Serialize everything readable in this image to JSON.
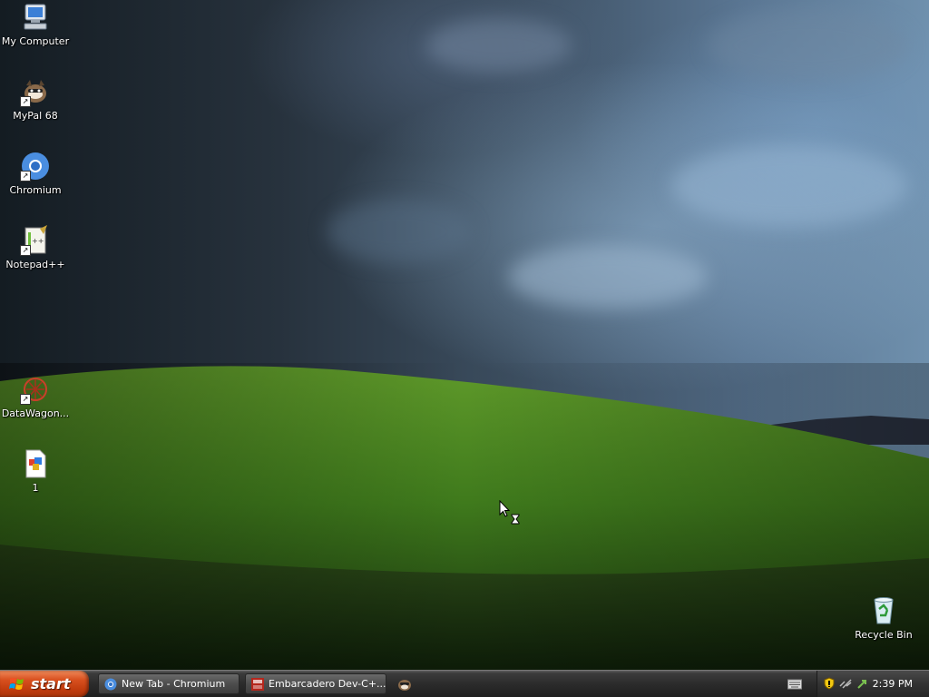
{
  "desktop": {
    "icons": [
      {
        "label": "My Computer",
        "icon": "my-computer-icon",
        "shortcut": false
      },
      {
        "label": "MyPal 68",
        "icon": "mypal-icon",
        "shortcut": true
      },
      {
        "label": "Chromium",
        "icon": "chromium-icon",
        "shortcut": true
      },
      {
        "label": "Notepad++",
        "icon": "notepad-plus-plus-icon",
        "shortcut": true
      },
      {
        "label": "DataWagon...",
        "icon": "datawagon-icon",
        "shortcut": true
      },
      {
        "label": "1",
        "icon": "image-file-icon",
        "shortcut": false
      },
      {
        "label": "Recycle Bin",
        "icon": "recycle-bin-icon",
        "shortcut": false
      }
    ],
    "cursor": "busy-arrow-hourglass"
  },
  "taskbar": {
    "start_label": "start",
    "tasks": [
      {
        "label": "New Tab - Chromium",
        "icon": "chromium-icon"
      },
      {
        "label": "Embarcadero Dev-C+...",
        "icon": "devcpp-icon"
      }
    ],
    "quick_launch_icon": "mypal-icon",
    "tray": {
      "clock": "2:39 PM",
      "icons": [
        "keyboard-icon",
        "security-shield-icon",
        "network-icon",
        "usb-icon"
      ]
    }
  },
  "colors": {
    "start_button": "#d8501f",
    "taskbar": "#2a2a2a",
    "label_text": "#ffffff"
  }
}
